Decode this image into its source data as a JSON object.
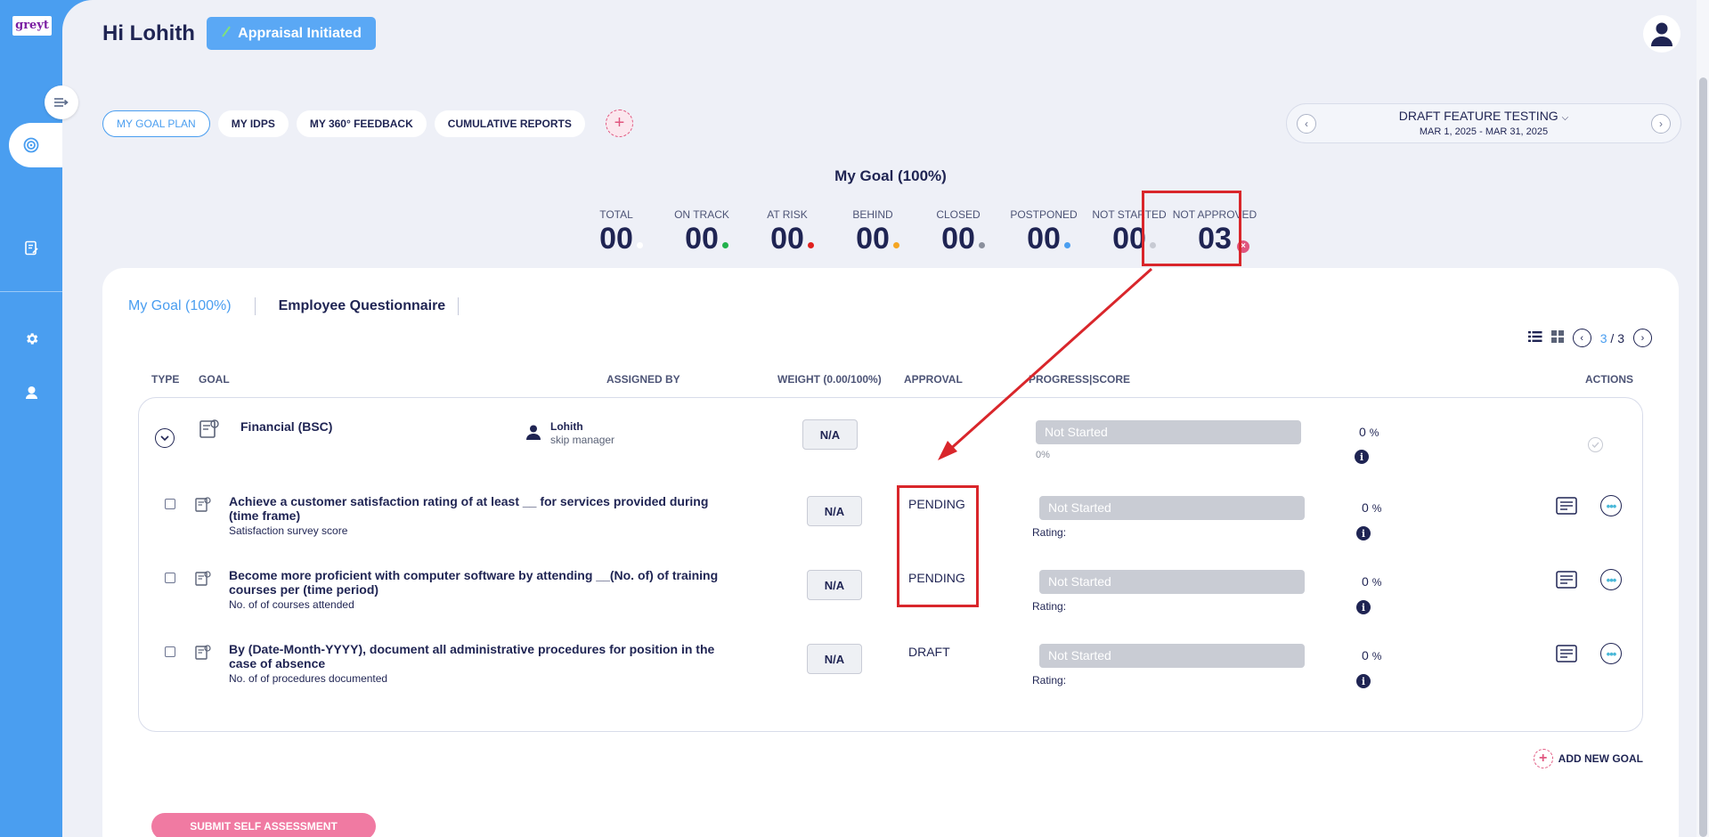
{
  "app": {
    "logo_text": "greyt",
    "accent": "#4a9ef0",
    "highlight": "#d9262b"
  },
  "header": {
    "greeting": "Hi Lohith",
    "status_label": "Appraisal Initiated"
  },
  "tabs": [
    {
      "label": "MY GOAL PLAN",
      "active": true
    },
    {
      "label": "MY IDPS"
    },
    {
      "label": "MY 360° FEEDBACK"
    },
    {
      "label": "CUMULATIVE REPORTS"
    }
  ],
  "add_tab_icon": "+",
  "period": {
    "name": "DRAFT FEATURE TESTING",
    "dates": "MAR 1, 2025 - MAR 31, 2025"
  },
  "summary": {
    "title": "My Goal (100%)",
    "stats": [
      {
        "label": "TOTAL",
        "value": "00",
        "color": "#ffffff"
      },
      {
        "label": "ON TRACK",
        "value": "00",
        "color": "#22b14c"
      },
      {
        "label": "AT RISK",
        "value": "00",
        "color": "#e0201e"
      },
      {
        "label": "BEHIND",
        "value": "00",
        "color": "#f5a623"
      },
      {
        "label": "CLOSED",
        "value": "00",
        "color": "#8a8f9c"
      },
      {
        "label": "POSTPONED",
        "value": "00",
        "color": "#4a9ef0"
      },
      {
        "label": "NOT STARTED",
        "value": "00",
        "color": "#c7cad3"
      },
      {
        "label": "NOT APPROVED",
        "value": "03",
        "color": "#e0567f"
      }
    ]
  },
  "subtabs": [
    {
      "label": "My Goal (100%)",
      "active": true
    },
    {
      "label": "Employee Questionnaire"
    }
  ],
  "pager": {
    "current": "3",
    "sep": "/",
    "total": "3"
  },
  "columns": {
    "type": "TYPE",
    "goal": "GOAL",
    "assigned_by": "ASSIGNED BY",
    "weight": "WEIGHT (0.00/100%)",
    "approval": "APPROVAL",
    "progress": "PROGRESS|SCORE",
    "actions": "ACTIONS"
  },
  "group": {
    "name": "Financial (BSC)",
    "assignee_name": "Lohith",
    "assignee_role": "skip manager",
    "weight": "N/A",
    "progress_status": "Not Started",
    "progress_pct": "0",
    "pct_sign": "%",
    "progress_caption": "0%"
  },
  "goals": [
    {
      "name": "Achieve a customer satisfaction rating of at least __ for services provided during (time frame)",
      "measure": "Satisfaction survey score",
      "weight": "N/A",
      "approval": "PENDING",
      "progress_status": "Not Started",
      "rating_label": "Rating:",
      "pct": "0",
      "pct_sign": "%"
    },
    {
      "name": "Become more proficient with computer software by attending __(No. of) of training courses per (time period)",
      "measure": "No. of of courses attended",
      "weight": "N/A",
      "approval": "PENDING",
      "progress_status": "Not Started",
      "rating_label": "Rating:",
      "pct": "0",
      "pct_sign": "%"
    },
    {
      "name": "By (Date-Month-YYYY), document all administrative procedures for position in the case of absence",
      "measure": "No. of of procedures documented",
      "weight": "N/A",
      "approval": "DRAFT",
      "progress_status": "Not Started",
      "rating_label": "Rating:",
      "pct": "0",
      "pct_sign": "%"
    }
  ],
  "add_goal_label": "ADD NEW GOAL",
  "submit_label": "SUBMIT SELF ASSESSMENT",
  "icons": {
    "collapse": "collapse-sidebar-icon",
    "goals": "target-icon",
    "notes": "notes-icon",
    "settings": "gear-icon",
    "user": "user-icon"
  }
}
